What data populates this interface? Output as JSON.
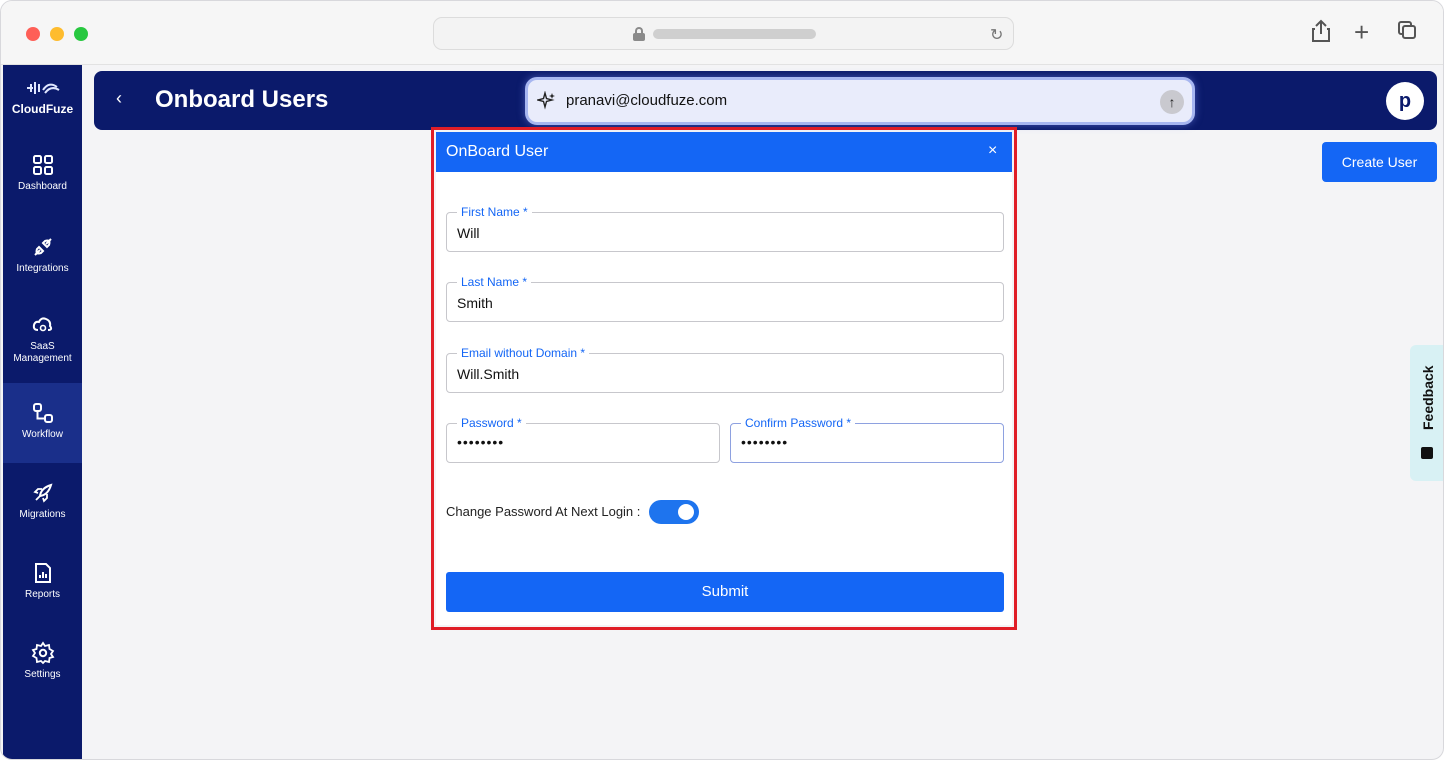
{
  "sidebar": {
    "logo_text": "CloudFuze",
    "items": [
      {
        "label": "Dashboard"
      },
      {
        "label": "Integrations"
      },
      {
        "label": "SaaS Management"
      },
      {
        "label": "Workflow"
      },
      {
        "label": "Migrations"
      },
      {
        "label": "Reports"
      },
      {
        "label": "Settings"
      }
    ]
  },
  "header": {
    "back_icon": "‹",
    "title": "Onboard Users",
    "avatar_initial": "p"
  },
  "prompt": {
    "text": "pranavi@cloudfuze.com"
  },
  "create_user_label": "Create User",
  "feedback_label": "Feedback",
  "modal": {
    "title": "OnBoard User",
    "close": "×",
    "first_name": {
      "label": "First Name *",
      "value": "Will"
    },
    "last_name": {
      "label": "Last Name *",
      "value": "Smith"
    },
    "email": {
      "label": "Email without Domain *",
      "value": "Will.Smith"
    },
    "password": {
      "label": "Password *",
      "value": "••••••••"
    },
    "confirm_password": {
      "label": "Confirm Password *",
      "value": "••••••••"
    },
    "change_password_label": "Change Password At Next Login :",
    "change_password_on": true,
    "submit_label": "Submit"
  },
  "colors": {
    "navy": "#0b1a6b",
    "primary": "#1466f5",
    "highlight": "#e01e27"
  }
}
